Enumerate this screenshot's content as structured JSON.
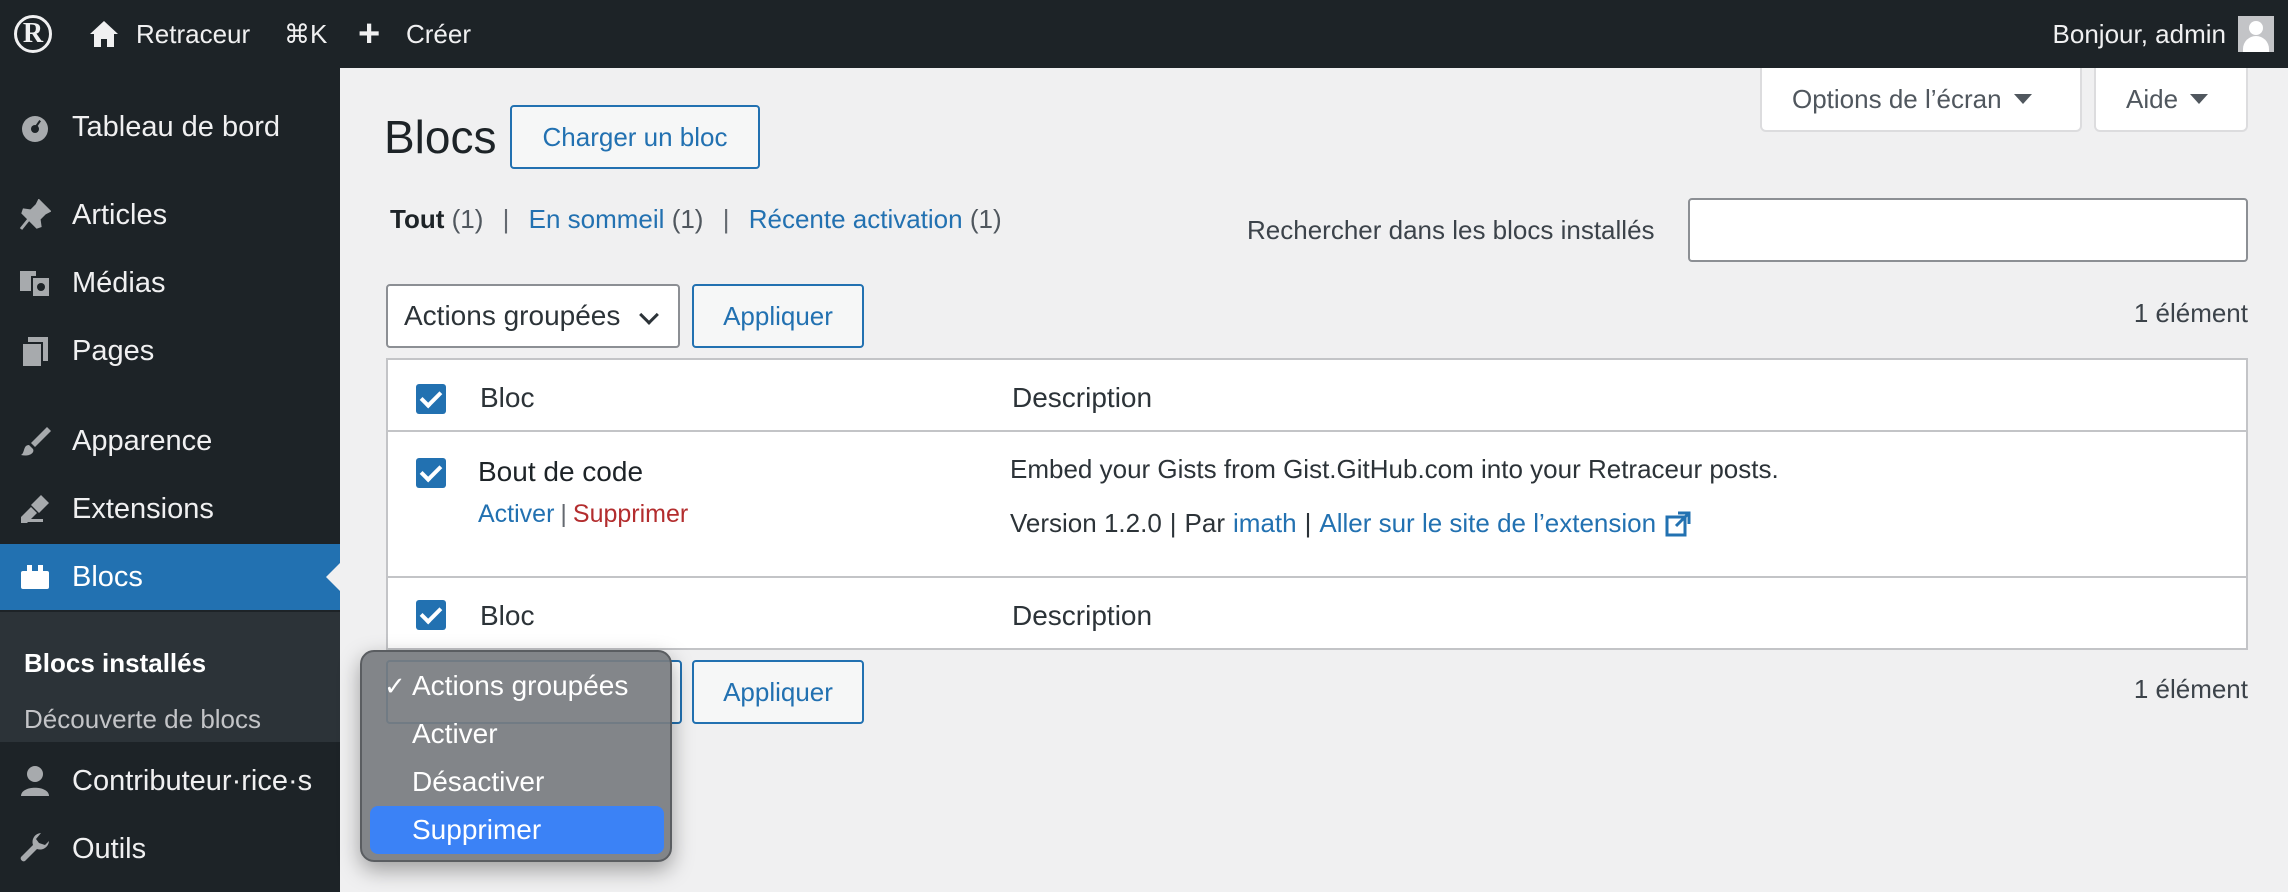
{
  "adminbar": {
    "site_name": "Retraceur",
    "shortcut": "⌘K",
    "create": "Créer",
    "greeting": "Bonjour, admin"
  },
  "sidebar": {
    "items": [
      {
        "label": "Tableau de bord",
        "icon": "dashboard-icon"
      },
      {
        "label": "Articles",
        "icon": "pin-icon"
      },
      {
        "label": "Médias",
        "icon": "media-icon"
      },
      {
        "label": "Pages",
        "icon": "pages-icon"
      },
      {
        "label": "Apparence",
        "icon": "brush-icon"
      },
      {
        "label": "Extensions",
        "icon": "plugin-icon"
      },
      {
        "label": "Blocs",
        "icon": "blocks-icon"
      },
      {
        "label": "Contributeur·rice·s",
        "icon": "user-icon"
      },
      {
        "label": "Outils",
        "icon": "wrench-icon"
      }
    ],
    "submenu": [
      "Blocs installés",
      "Découverte de blocs"
    ]
  },
  "header": {
    "screen_options": "Options de l’écran",
    "help": "Aide",
    "title": "Blocs",
    "upload_button": "Charger un bloc"
  },
  "filters": {
    "all": "Tout",
    "all_count": "(1)",
    "inactive": "En sommeil",
    "inactive_count": "(1)",
    "recent": "Récente activation",
    "recent_count": "(1)"
  },
  "search": {
    "label": "Rechercher dans les blocs installés",
    "value": ""
  },
  "bulk": {
    "select_label": "Actions groupées",
    "apply": "Appliquer",
    "count": "1 élément"
  },
  "table": {
    "col_block": "Bloc",
    "col_desc": "Description",
    "rows": [
      {
        "name": "Bout de code",
        "activate": "Activer",
        "delete": "Supprimer",
        "description": "Embed your Gists from Gist.GitHub.com into your Retraceur posts.",
        "version": "Version 1.2.0",
        "by": "Par",
        "author": "imath",
        "site_link": "Aller sur le site de l’extension"
      }
    ]
  },
  "dropdown": {
    "options": [
      "Actions groupées",
      "Activer",
      "Désactiver",
      "Supprimer"
    ],
    "checked": "Actions groupées",
    "highlighted": "Supprimer"
  },
  "colors": {
    "admin_dark": "#1d2327",
    "accent": "#2271b1",
    "delete": "#b32d2e",
    "highlight": "#3b82f6"
  }
}
